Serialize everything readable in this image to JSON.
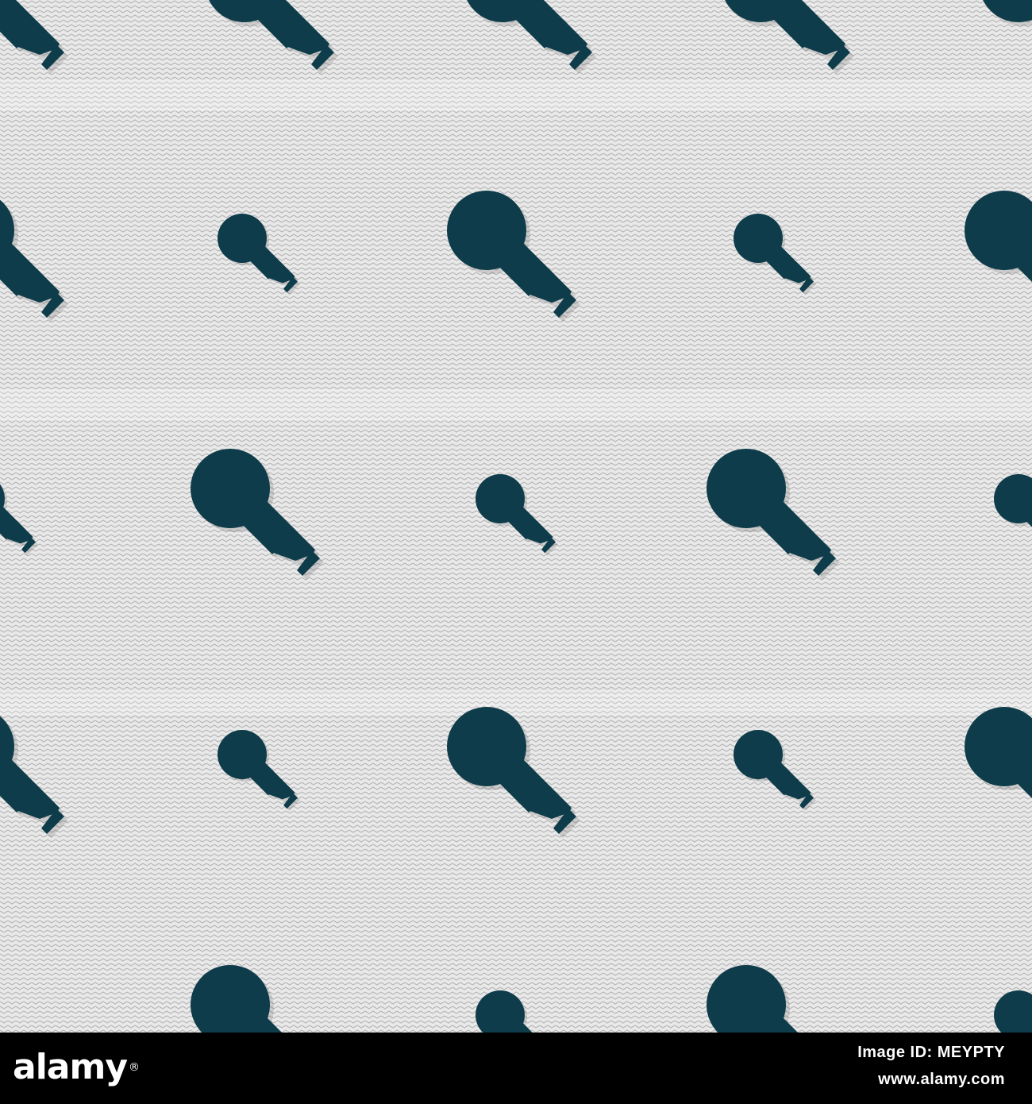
{
  "pattern": {
    "background_color": "#e9e9e9",
    "zigzag_color": "#b8b8b8",
    "icon_color": "#0e3c4a",
    "icon": "microphone-icon"
  },
  "footer": {
    "logo": "alamy",
    "image_id": "Image ID: MEYPTY",
    "site": "www.alamy.com"
  }
}
